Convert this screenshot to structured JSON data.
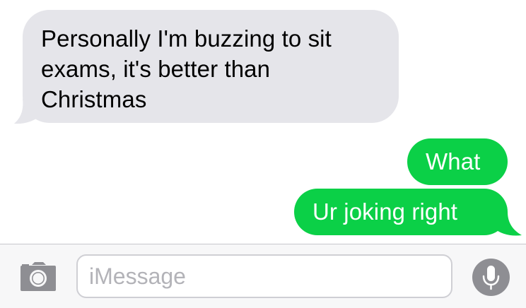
{
  "conversation": {
    "messages": [
      {
        "direction": "incoming",
        "text": "Personally I'm buzzing to sit exams, it's better than Christmas"
      },
      {
        "direction": "outgoing",
        "text": "What"
      },
      {
        "direction": "outgoing",
        "text": "Ur joking right"
      }
    ]
  },
  "composer": {
    "placeholder": "iMessage",
    "camera_icon": "camera-icon",
    "mic_icon": "microphone-icon"
  },
  "colors": {
    "incoming_bubble": "#e5e5ea",
    "outgoing_bubble": "#0bd047",
    "mic_button": "#8e8e93"
  }
}
